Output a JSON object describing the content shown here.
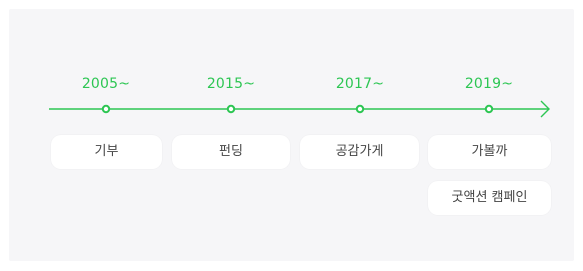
{
  "timeline": {
    "accent_color": "#2dc653",
    "milestones": [
      {
        "year": "2005~",
        "items": [
          "기부"
        ]
      },
      {
        "year": "2015~",
        "items": [
          "펀딩"
        ]
      },
      {
        "year": "2017~",
        "items": [
          "공감가게"
        ]
      },
      {
        "year": "2019~",
        "items": [
          "가볼까",
          "굿액션 캠페인"
        ]
      }
    ]
  }
}
